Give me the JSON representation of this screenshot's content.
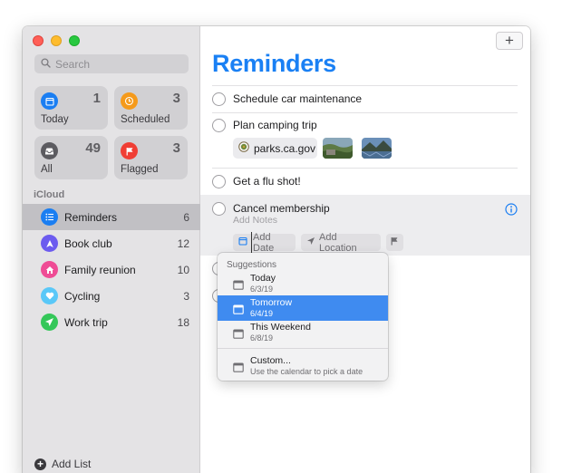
{
  "sidebar": {
    "search_placeholder": "Search",
    "tiles": [
      {
        "label": "Today",
        "count": "1",
        "color": "#1a7ef2",
        "icon": "calendar-icon"
      },
      {
        "label": "Scheduled",
        "count": "3",
        "color": "#f59a1b",
        "icon": "clock-icon"
      },
      {
        "label": "All",
        "count": "49",
        "color": "#5c5b60",
        "icon": "tray-icon"
      },
      {
        "label": "Flagged",
        "count": "3",
        "color": "#f03e34",
        "icon": "flag-icon"
      }
    ],
    "section_label": "iCloud",
    "lists": [
      {
        "name": "Reminders",
        "count": "6",
        "color": "#1a7ef2",
        "icon": "list-icon"
      },
      {
        "name": "Book club",
        "count": "12",
        "color": "#6c5bef",
        "icon": "bookmark-icon"
      },
      {
        "name": "Family reunion",
        "count": "10",
        "color": "#ef4c95",
        "icon": "house-icon"
      },
      {
        "name": "Cycling",
        "count": "3",
        "color": "#5ac8f8",
        "icon": "heart-icon"
      },
      {
        "name": "Work trip",
        "count": "18",
        "color": "#34c759",
        "icon": "airplane-icon"
      }
    ],
    "add_list_label": "Add List"
  },
  "main": {
    "title": "Reminders",
    "title_color": "#1a80f4",
    "new_button": "+",
    "reminders": [
      {
        "title": "Schedule car maintenance"
      },
      {
        "title": "Plan camping trip",
        "link": "parks.ca.gov"
      },
      {
        "title": "Get a flu shot!"
      },
      {
        "title": "Cancel membership",
        "notes_placeholder": "Add Notes"
      }
    ],
    "chips": {
      "add_date": "Add Date",
      "add_location": "Add Location"
    }
  },
  "popup": {
    "header": "Suggestions",
    "options": [
      {
        "title": "Today",
        "date": "6/3/19"
      },
      {
        "title": "Tomorrow",
        "date": "6/4/19",
        "selected": true
      },
      {
        "title": "This Weekend",
        "date": "6/8/19"
      },
      {
        "title": "Custom...",
        "date": "Use the calendar to pick a date"
      }
    ]
  }
}
